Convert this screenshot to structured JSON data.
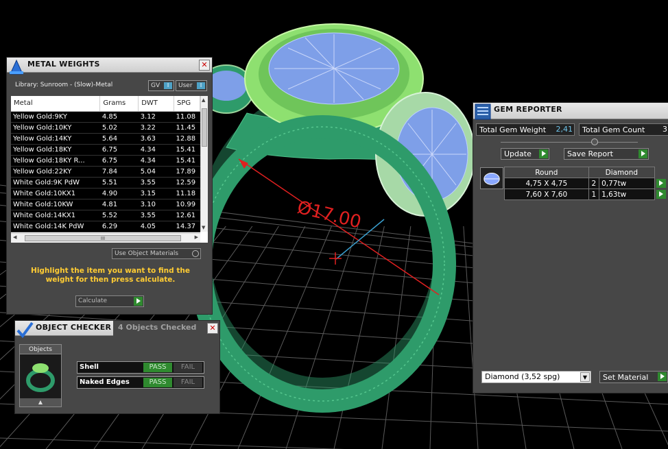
{
  "viewport": {
    "dimension_label": "Ø17.00"
  },
  "metal_weights": {
    "title": "METAL WEIGHTS",
    "library": "Library: Sunroom - (Slow)-Metal",
    "toggle_gv": "GV",
    "toggle_user": "User",
    "columns": [
      "Metal",
      "Grams",
      "DWT",
      "SPG"
    ],
    "rows": [
      [
        "Yellow Gold:9KY",
        "4.85",
        "3.12",
        "11.08"
      ],
      [
        "Yellow Gold:10KY",
        "5.02",
        "3.22",
        "11.45"
      ],
      [
        "Yellow Gold:14KY",
        "5.64",
        "3.63",
        "12.88"
      ],
      [
        "Yellow Gold:18KY",
        "6.75",
        "4.34",
        "15.41"
      ],
      [
        "Yellow Gold:18KY R...",
        "6.75",
        "4.34",
        "15.41"
      ],
      [
        "Yellow Gold:22KY",
        "7.84",
        "5.04",
        "17.89"
      ],
      [
        "White Gold:9K PdW",
        "5.51",
        "3.55",
        "12.59"
      ],
      [
        "White Gold:10KX1",
        "4.90",
        "3.15",
        "11.18"
      ],
      [
        "White Gold:10KW",
        "4.81",
        "3.10",
        "10.99"
      ],
      [
        "White Gold:14KX1",
        "5.52",
        "3.55",
        "12.61"
      ],
      [
        "White Gold:14K PdW",
        "6.29",
        "4.05",
        "14.37"
      ]
    ],
    "use_object_materials": "Use Object Materials",
    "hint": "Highlight the item you want to find the weight for then press calculate.",
    "calculate": "Calculate"
  },
  "object_checker": {
    "title": "OBJECT CHECKER",
    "count_text": "4  Objects Checked",
    "objects_label": "Objects",
    "checks": [
      {
        "label": "Shell",
        "pass": "PASS",
        "fail": "FAIL"
      },
      {
        "label": "Naked Edges",
        "pass": "PASS",
        "fail": "FAIL"
      }
    ]
  },
  "gem_reporter": {
    "title": "GEM REPORTER",
    "total_weight_label": "Total Gem Weight",
    "total_weight_value": "2,41",
    "total_count_label": "Total Gem Count",
    "total_count_value": "3",
    "update": "Update",
    "save_report": "Save Report",
    "columns": [
      "Round",
      "Diamond"
    ],
    "rows": [
      {
        "size": "4,75 X 4,75",
        "count": "2",
        "weight": "0,77tw"
      },
      {
        "size": "7,60 X 7,60",
        "count": "1",
        "weight": "1,63tw"
      }
    ],
    "material": "Diamond     (3,52 spg)",
    "set_material": "Set Material"
  },
  "colors": {
    "ring_green": "#2e9b6a",
    "head_green": "#8ee070",
    "gem_blue": "#7e9fe8",
    "pass_green": "#2f8a2f",
    "hint_yellow": "#ffcc33",
    "dimension_red": "#e02020"
  }
}
